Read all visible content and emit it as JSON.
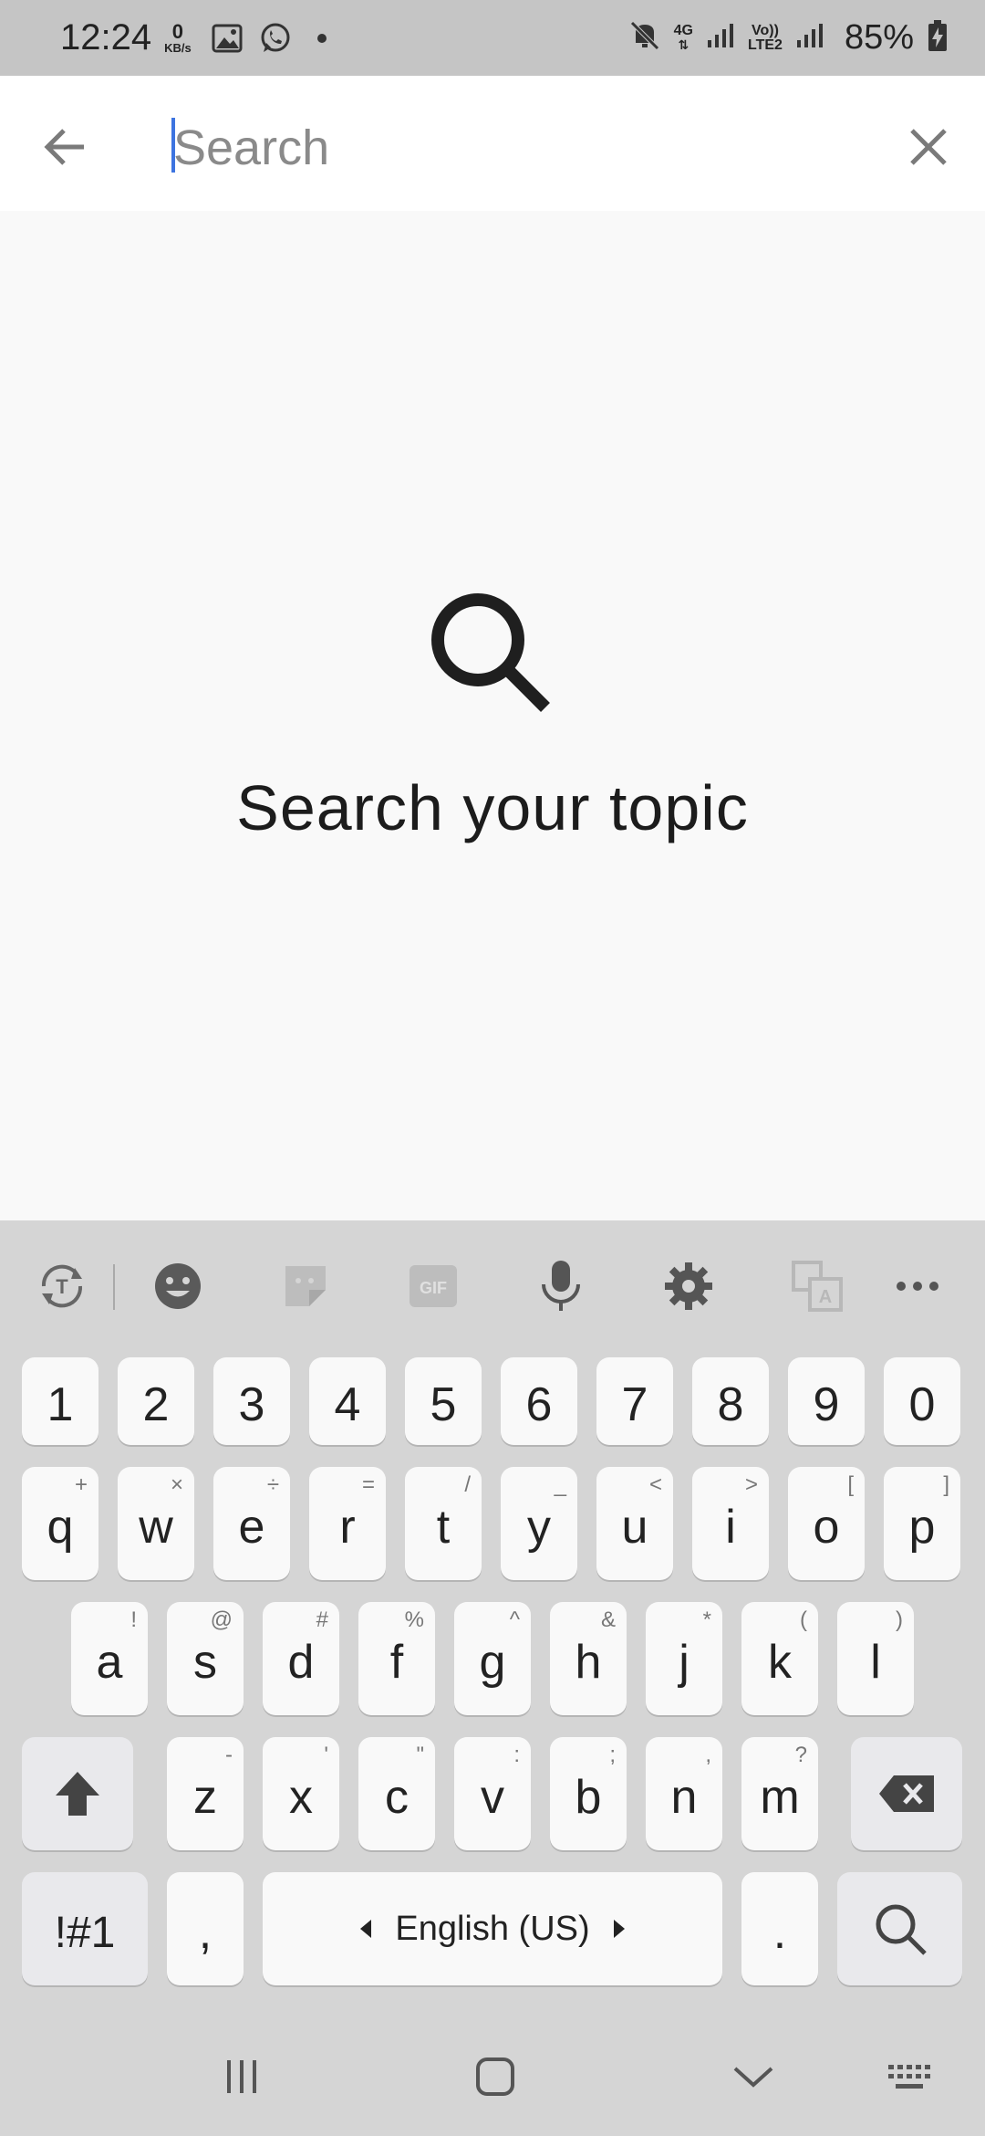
{
  "status_bar": {
    "time": "12:24",
    "speed_value": "0",
    "speed_unit": "KB/s",
    "network_4g": "4G",
    "volte_label_top": "Vo))",
    "volte_label_bottom": "LTE2",
    "battery_percent": "85%",
    "icons": [
      "gallery-icon",
      "whatsapp-icon",
      "mute-icon",
      "signal-icon",
      "battery-charging-icon"
    ]
  },
  "search_header": {
    "placeholder": "Search",
    "value": ""
  },
  "empty_state": {
    "message": "Search your topic",
    "icon": "search-icon"
  },
  "keyboard": {
    "toolbar_icons": [
      "text-recognition-icon",
      "emoji-icon",
      "sticker-icon",
      "gif-icon",
      "mic-icon",
      "settings-icon",
      "translate-icon",
      "more-icon"
    ],
    "gif_label": "GIF",
    "number_row": [
      "1",
      "2",
      "3",
      "4",
      "5",
      "6",
      "7",
      "8",
      "9",
      "0"
    ],
    "row1": [
      {
        "main": "q",
        "sub": "+"
      },
      {
        "main": "w",
        "sub": "×"
      },
      {
        "main": "e",
        "sub": "÷"
      },
      {
        "main": "r",
        "sub": "="
      },
      {
        "main": "t",
        "sub": "/"
      },
      {
        "main": "y",
        "sub": "_"
      },
      {
        "main": "u",
        "sub": "<"
      },
      {
        "main": "i",
        "sub": ">"
      },
      {
        "main": "o",
        "sub": "["
      },
      {
        "main": "p",
        "sub": "]"
      }
    ],
    "row2": [
      {
        "main": "a",
        "sub": "!"
      },
      {
        "main": "s",
        "sub": "@"
      },
      {
        "main": "d",
        "sub": "#"
      },
      {
        "main": "f",
        "sub": "%"
      },
      {
        "main": "g",
        "sub": "^"
      },
      {
        "main": "h",
        "sub": "&"
      },
      {
        "main": "j",
        "sub": "*"
      },
      {
        "main": "k",
        "sub": "("
      },
      {
        "main": "l",
        "sub": ")"
      }
    ],
    "row3": [
      {
        "main": "z",
        "sub": "-"
      },
      {
        "main": "x",
        "sub": "'"
      },
      {
        "main": "c",
        "sub": "\""
      },
      {
        "main": "v",
        "sub": ":"
      },
      {
        "main": "b",
        "sub": ";"
      },
      {
        "main": "n",
        "sub": ","
      },
      {
        "main": "m",
        "sub": "?"
      }
    ],
    "symbols_label": "!#1",
    "comma_label": ",",
    "space_label": "English (US)",
    "period_label": "."
  },
  "nav_bar": {
    "icons": [
      "recent-apps-icon",
      "home-icon",
      "hide-keyboard-icon",
      "keyboard-switch-icon"
    ]
  }
}
